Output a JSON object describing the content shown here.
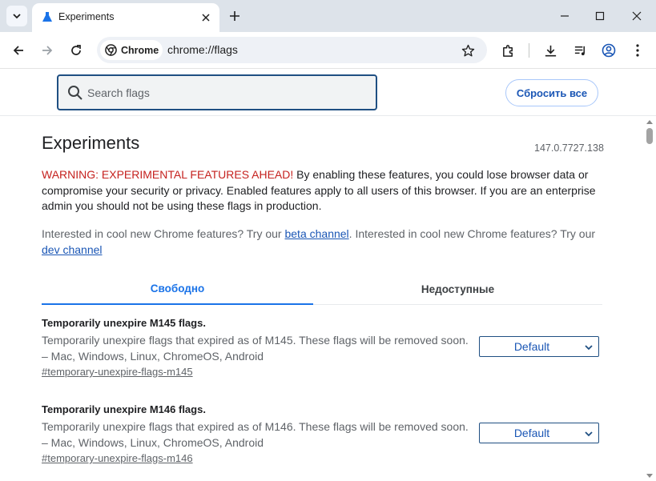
{
  "window": {
    "tab_title": "Experiments",
    "icons": [
      "tab-search-icon",
      "flask-icon",
      "close-icon",
      "plus-icon",
      "minimize-icon",
      "maximize-icon",
      "close-window-icon"
    ]
  },
  "toolbar": {
    "chip_label": "Chrome",
    "url": "chrome://flags",
    "icons": [
      "back-icon",
      "forward-icon",
      "reload-icon",
      "chrome-icon",
      "bookmark-star-icon",
      "extensions-icon",
      "download-icon",
      "media-control-icon",
      "profile-icon",
      "menu-icon"
    ]
  },
  "header": {
    "search_placeholder": "Search flags",
    "reset_label": "Сбросить все"
  },
  "page": {
    "title": "Experiments",
    "version": "147.0.7727.138",
    "warning_prefix": "WARNING: EXPERIMENTAL FEATURES AHEAD!",
    "warning_body": " By enabling these features, you could lose browser data or compromise your security or privacy. Enabled features apply to all users of this browser. If you are an enterprise admin you should not be using these flags in production.",
    "interested_1": "Interested in cool new Chrome features? Try our ",
    "beta_link": "beta channel",
    "interested_2": ". Interested in cool new Chrome features? Try our ",
    "dev_link": "dev channel"
  },
  "tabs": [
    {
      "label": "Свободно",
      "active": true
    },
    {
      "label": "Недоступные",
      "active": false
    }
  ],
  "flags": [
    {
      "name": "Temporarily unexpire M145 flags.",
      "description": "Temporarily unexpire flags that expired as of M145. These flags will be removed soon. – Mac, Windows, Linux, ChromeOS, Android",
      "link": "#temporary-unexpire-flags-m145",
      "value": "Default"
    },
    {
      "name": "Temporarily unexpire M146 flags.",
      "description": "Temporarily unexpire flags that expired as of M146. These flags will be removed soon. – Mac, Windows, Linux, ChromeOS, Android",
      "link": "#temporary-unexpire-flags-m146",
      "value": "Default"
    }
  ],
  "colors": {
    "accent": "#1a73e8",
    "warning": "#c5221f",
    "tabstrip": "#dde3ea"
  }
}
